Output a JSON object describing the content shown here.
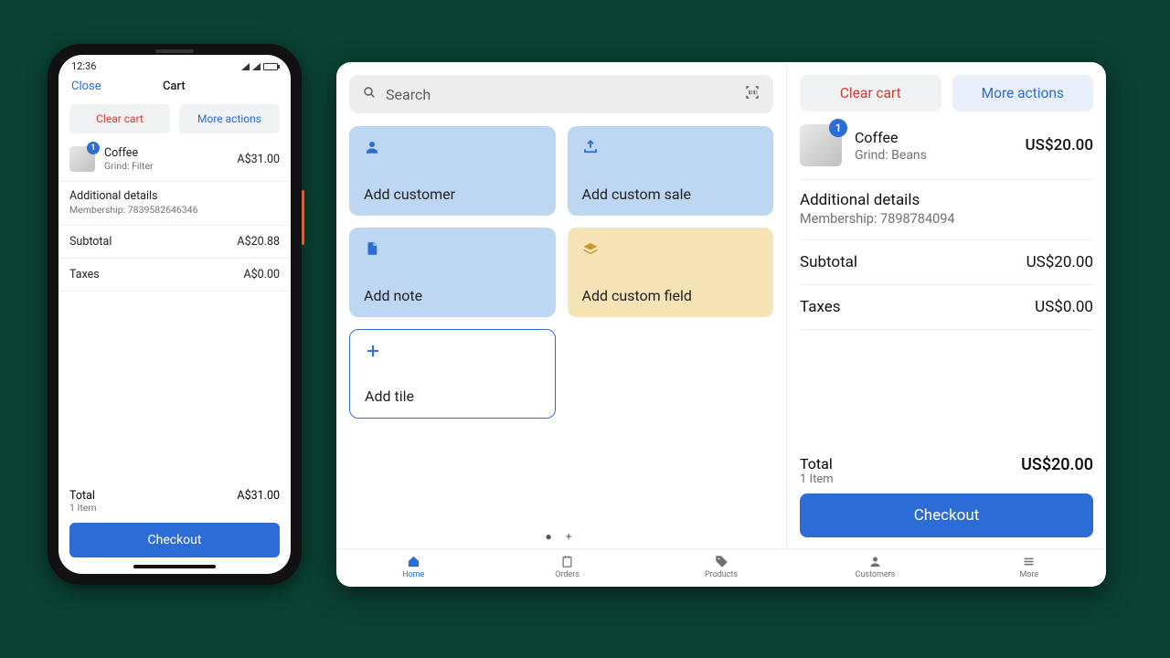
{
  "phone": {
    "status_time": "12:36",
    "close_label": "Close",
    "title": "Cart",
    "clear_cart": "Clear cart",
    "more_actions": "More actions",
    "item": {
      "qty": "1",
      "name": "Coffee",
      "sub": "Grind: Filter",
      "price": "A$31.00"
    },
    "details_title": "Additional details",
    "details_value": "Membership: 7839582646346",
    "subtotal_label": "Subtotal",
    "subtotal_value": "A$20.88",
    "taxes_label": "Taxes",
    "taxes_value": "A$0.00",
    "total_label": "Total",
    "total_items": "1 Item",
    "total_value": "A$31.00",
    "checkout": "Checkout"
  },
  "tablet": {
    "search_placeholder": "Search",
    "tiles": {
      "add_customer": "Add customer",
      "add_custom_sale": "Add custom sale",
      "add_note": "Add note",
      "add_custom_field": "Add custom field",
      "add_tile": "Add tile"
    },
    "cart": {
      "clear_cart": "Clear cart",
      "more_actions": "More actions",
      "item": {
        "qty": "1",
        "name": "Coffee",
        "sub": "Grind: Beans",
        "price": "US$20.00"
      },
      "details_title": "Additional details",
      "details_value": "Membership: 7898784094",
      "subtotal_label": "Subtotal",
      "subtotal_value": "US$20.00",
      "taxes_label": "Taxes",
      "taxes_value": "US$0.00",
      "total_label": "Total",
      "total_items": "1 Item",
      "total_value": "US$20.00",
      "checkout": "Checkout"
    },
    "tabs": {
      "home": "Home",
      "orders": "Orders",
      "products": "Products",
      "customers": "Customers",
      "more": "More"
    }
  }
}
